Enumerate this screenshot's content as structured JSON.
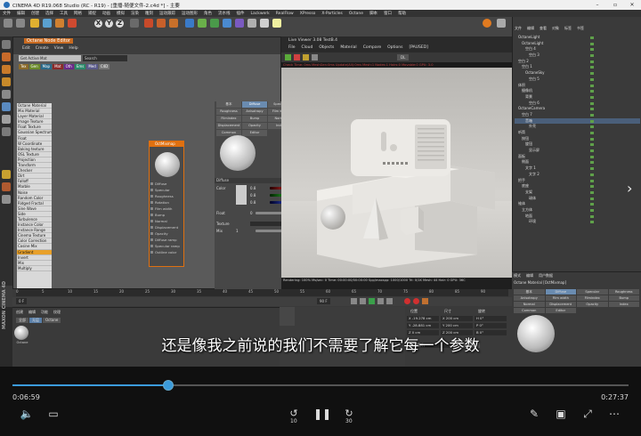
{
  "window": {
    "title": "CINEMA 4D R19.068 Studio (RC - R19) - [重播-随便文件-2.c4d *] - 主要",
    "menu": [
      "文件",
      "编辑",
      "创建",
      "选择",
      "工具",
      "网格",
      "捕捉",
      "动画",
      "模拟",
      "渲染",
      "雕刻",
      "运动跟踪",
      "运动图形",
      "角色",
      "流水线",
      "插件",
      "Lackwerk",
      "RealFlow",
      "XPresso",
      "X-Particles",
      "Octane",
      "脚本",
      "窗口",
      "帮助"
    ]
  },
  "toolbar": {
    "axis_labels": [
      "X",
      "Y",
      "Z"
    ]
  },
  "node_editor": {
    "title": "Octane Node Editor",
    "menu": [
      "Edit",
      "Create",
      "View",
      "Help"
    ],
    "search_placeholder": "Get Active Mat",
    "search_button": "Search",
    "tabs": [
      "Tex",
      "Gen",
      "Map",
      "Mat",
      "Oth",
      "Ems",
      "Med",
      "C4D"
    ],
    "node_list": [
      "Octane Material",
      "Mix Material",
      "Layer Material",
      "Image Texture",
      "Float Texture",
      "Gaussian Spectrum",
      "Float",
      "W Coordinate",
      "Baking texture",
      "OSL Texture",
      "Projection",
      "Transform",
      "Checker",
      "Dirt",
      "Falloff",
      "Marble",
      "Noise",
      "Random Color",
      "Ridged Fractal",
      "Sine Wave",
      "Side",
      "Turbulence",
      "Instance Color",
      "Instance Range",
      "Cinema Texture",
      "Color Correction",
      "Cosine Mix",
      "Gradient",
      "Invert",
      "Mix",
      "Multiply"
    ],
    "node_list_selected": 27,
    "octane_node": {
      "title": "OctMixmap",
      "pins": [
        "Diffuse",
        "Specular",
        "Roughness",
        "Rotation",
        "Film width",
        "Bump",
        "Normal",
        "Displacement",
        "Opacity",
        "Diffuse ramp",
        "Specular ramp",
        "Outline color"
      ]
    }
  },
  "material_attrs": {
    "tabs": [
      "基本",
      "Diffuse",
      "Specular",
      "Roughness",
      "Anisotropy",
      "Film width",
      "Filmindex",
      "Bump",
      "Normal",
      "Displacement",
      "Opacity",
      "Index",
      "Common",
      "Editor"
    ],
    "active_tab": "Diffuse",
    "section": "Diffuse",
    "color_label": "Color",
    "color_values": [
      "0.8",
      "0.8",
      "0.8"
    ],
    "float_label": "Float",
    "float_value": "0",
    "texture_label": "Texture",
    "mix_label": "Mix",
    "mix_value": "1"
  },
  "viewer": {
    "title": "Live Viewer 3.08 TestB.4",
    "menu": [
      "File",
      "Cloud",
      "Objects",
      "Material",
      "Compare",
      "Options",
      "[PAUSED]"
    ],
    "status_line": "Check Time: 0ms  MeshGen:0ms  Update(All):0ms  Mesh:1 Nodes:1 Hairs:0 Movable:0 GPU: 3.0",
    "render_mode": "DL",
    "footer": "Rendering: 100%  Ms/sec: 0  Time: 00:00:00/00:00:00  Spp/maxspp: 1000/1000  Tri: 0/1K  Mesh: 44  Hair: 0  GPU: 36C"
  },
  "object_manager": {
    "menu": [
      "文件",
      "编辑",
      "查看",
      "对象",
      "标签",
      "书签"
    ],
    "objects": [
      "OctaneLight",
      "OctaneLight",
      "空白 4",
      "空白 3",
      "空白 2",
      "空白 1",
      "OctaneSky",
      "空白 5",
      "体积",
      "摄像机",
      "背景",
      "空白 6",
      "OctaneCamera",
      "空白 7",
      "音箱",
      "外壳",
      "听筒",
      "按钮",
      "旋钮",
      "显示屏",
      "面板",
      "侧面",
      "文字 1",
      "文字 2",
      "把手",
      "底座",
      "支架",
      "球体",
      "锥体",
      "立方体",
      "地面",
      "环境"
    ],
    "selected": 14
  },
  "attribute_manager": {
    "menu": [
      "模式",
      "编辑",
      "用户数据"
    ],
    "name": "Octane Material [OctMixmap]",
    "tabs": [
      "基本",
      "Diffuse",
      "Specular",
      "Roughness",
      "Anisotropy",
      "Film width",
      "Filmindex",
      "Bump",
      "Normal",
      "Displacement",
      "Opacity",
      "Index",
      "Common",
      "Editor"
    ],
    "active_tab": "Diffuse"
  },
  "timeline": {
    "ticks": [
      "0",
      "5",
      "10",
      "15",
      "20",
      "25",
      "30",
      "35",
      "40",
      "45",
      "50",
      "55",
      "60",
      "65",
      "70",
      "75",
      "80",
      "85",
      "90"
    ],
    "start_frame": "0 F",
    "end_frame": "90 F"
  },
  "material_manager": {
    "menu": [
      "创建",
      "编辑",
      "功能",
      "纹理"
    ],
    "tabs": [
      "全部",
      "无层",
      "Octane"
    ],
    "active_tab": "无层",
    "material_name": "Octane"
  },
  "coordinates": {
    "headers": [
      "位置",
      "尺寸",
      "旋转"
    ],
    "rows": [
      [
        "X -19.278 cm",
        "X 200 cm",
        "H 0°"
      ],
      [
        "Y -28.881 cm",
        "Y 200 cm",
        "P 0°"
      ],
      [
        "Z 0 cm",
        "Z 200 cm",
        "B 0°"
      ]
    ],
    "mode": "对象(相对)",
    "apply": "应用"
  },
  "maxon_label": "MAXON CINEMA 4D",
  "subtitle": "还是像我之前说的我们不需要了解它每一个参数",
  "player": {
    "current_time": "0:06:59",
    "total_time": "0:27:37",
    "progress": 0.2529,
    "back_seconds": "10",
    "fwd_seconds": "30"
  },
  "colors": {
    "accent": "#3b9bdb",
    "node_orange": "#e07010"
  }
}
